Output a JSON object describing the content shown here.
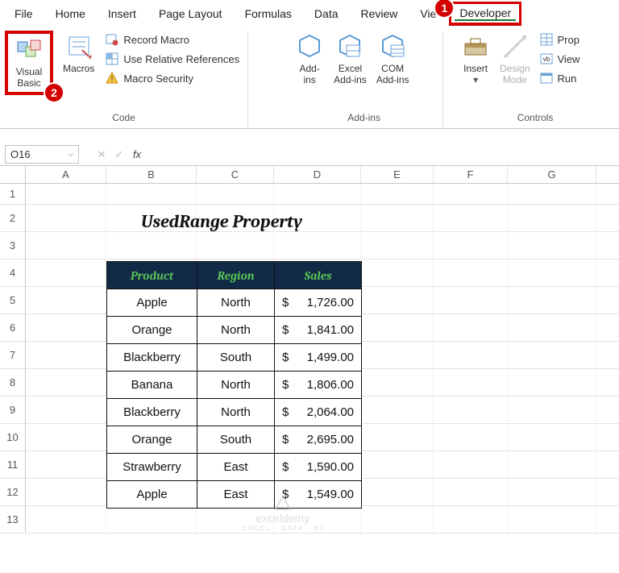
{
  "tabs": [
    "File",
    "Home",
    "Insert",
    "Page Layout",
    "Formulas",
    "Data",
    "Review",
    "Vie",
    "Developer"
  ],
  "badge1": "1",
  "badge2": "2",
  "ribbon": {
    "code": {
      "visual_basic_line1": "Visual",
      "visual_basic_line2": "Basic",
      "macros": "Macros",
      "record_macro": "Record Macro",
      "use_relative": "Use Relative References",
      "macro_security": "Macro Security",
      "label": "Code"
    },
    "addins": {
      "addins_line1": "Add-",
      "addins_line2": "ins",
      "excel_line1": "Excel",
      "excel_line2": "Add-ins",
      "com_line1": "COM",
      "com_line2": "Add-ins",
      "label": "Add-ins"
    },
    "controls": {
      "insert": "Insert",
      "design_line1": "Design",
      "design_line2": "Mode",
      "properties": "Prop",
      "view_code": "View",
      "run_dialog": "Run",
      "label": "Controls"
    }
  },
  "namebox": "O16",
  "cols": [
    "A",
    "B",
    "C",
    "D",
    "E",
    "F",
    "G"
  ],
  "rownums": [
    "1",
    "2",
    "3",
    "4",
    "5",
    "6",
    "7",
    "8",
    "9",
    "10",
    "11",
    "12",
    "13"
  ],
  "title": "UsedRange Property",
  "headers": [
    "Product",
    "Region",
    "Sales"
  ],
  "rows": [
    {
      "p": "Apple",
      "r": "North",
      "s": "1,726.00"
    },
    {
      "p": "Orange",
      "r": "North",
      "s": "1,841.00"
    },
    {
      "p": "Blackberry",
      "r": "South",
      "s": "1,499.00"
    },
    {
      "p": "Banana",
      "r": "North",
      "s": "1,806.00"
    },
    {
      "p": "Blackberry",
      "r": "North",
      "s": "2,064.00"
    },
    {
      "p": "Orange",
      "r": "South",
      "s": "2,695.00"
    },
    {
      "p": "Strawberry",
      "r": "East",
      "s": "1,590.00"
    },
    {
      "p": "Apple",
      "r": "East",
      "s": "1,549.00"
    }
  ],
  "watermark": {
    "main": "exceldemy",
    "sub": "EXCEL · DATA · BI"
  }
}
